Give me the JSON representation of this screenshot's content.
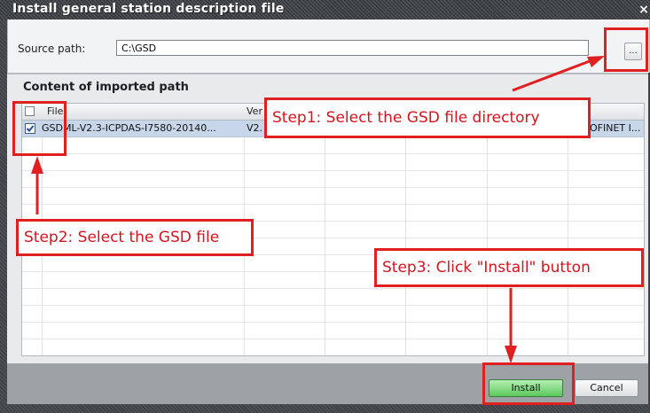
{
  "dialog": {
    "title": "Install general station description file",
    "close_glyph": "×"
  },
  "source": {
    "label": "Source path:",
    "value": "C:\\GSD",
    "browse_label": "..."
  },
  "content": {
    "section_title": "Content of imported path",
    "columns": [
      "File",
      "Ver",
      "",
      "",
      "",
      "",
      "o"
    ],
    "rows": [
      {
        "checked": true,
        "file": "GSDML-V2.3-ICPDAS-I7580-20140...",
        "version": "V2.",
        "type": "OFINET I..."
      }
    ]
  },
  "buttons": {
    "install": "Install",
    "cancel": "Cancel"
  },
  "annotations": {
    "step1": "Step1: Select the GSD file directory",
    "step2": "Step2: Select the GSD file",
    "step3": "Step3: Click \"Install\" button"
  },
  "colors": {
    "annotation_red": "#e02020",
    "install_green": "#5cc95c",
    "selection_blue": "#c7d6e8"
  },
  "icons": [
    "checkbox-checked-icon",
    "close-icon",
    "ellipsis-icon"
  ]
}
